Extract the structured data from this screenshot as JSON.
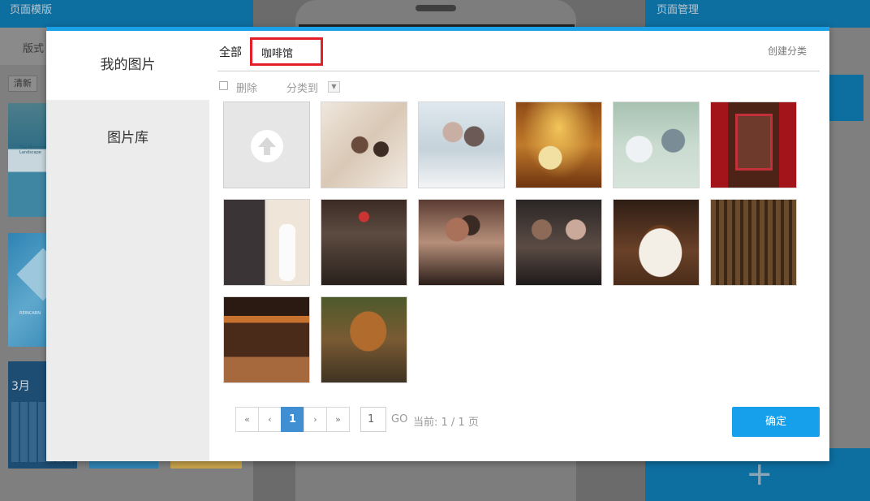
{
  "background": {
    "left_header_title": "页面模版",
    "left_tab_label": "版式",
    "left_clear_button": "清新",
    "right_header_title": "页面管理",
    "add_page_icon": "+",
    "thumb_texts": {
      "mountain": "The Mountain Landscape",
      "reincarnation": "REINCARN",
      "calendar": "3月"
    }
  },
  "modal": {
    "sidebar": {
      "my_images": "我的图片",
      "image_library": "图片库"
    },
    "categories": {
      "all": "全部",
      "selected": "咖啡馆",
      "create": "创建分类"
    },
    "toolbar": {
      "delete_label": "删除",
      "move_to_label": "分类到"
    },
    "upload_icon": "upload-arrow-icon",
    "images": [
      {
        "name": "wedding-couple-bed"
      },
      {
        "name": "wedding-kiss-veil"
      },
      {
        "name": "wedding-autumn-forest"
      },
      {
        "name": "wedding-couple-outdoor"
      },
      {
        "name": "couple-red-window"
      },
      {
        "name": "wedding-collage"
      },
      {
        "name": "couple-street-night"
      },
      {
        "name": "couple-cafe-kiss"
      },
      {
        "name": "couple-cafe-table"
      },
      {
        "name": "coffee-cup"
      },
      {
        "name": "cafe-interior-stairs"
      },
      {
        "name": "cafe-counter"
      },
      {
        "name": "cafe-sign-facade"
      }
    ],
    "pagination": {
      "first": "«",
      "prev": "‹",
      "current": "1",
      "next": "›",
      "last": "»",
      "input_value": "1",
      "go": "GO",
      "status": "当前: 1 / 1 页"
    },
    "confirm_button": "确定",
    "accent_color": "#16a0ec",
    "highlight_color": "#e3202a"
  }
}
